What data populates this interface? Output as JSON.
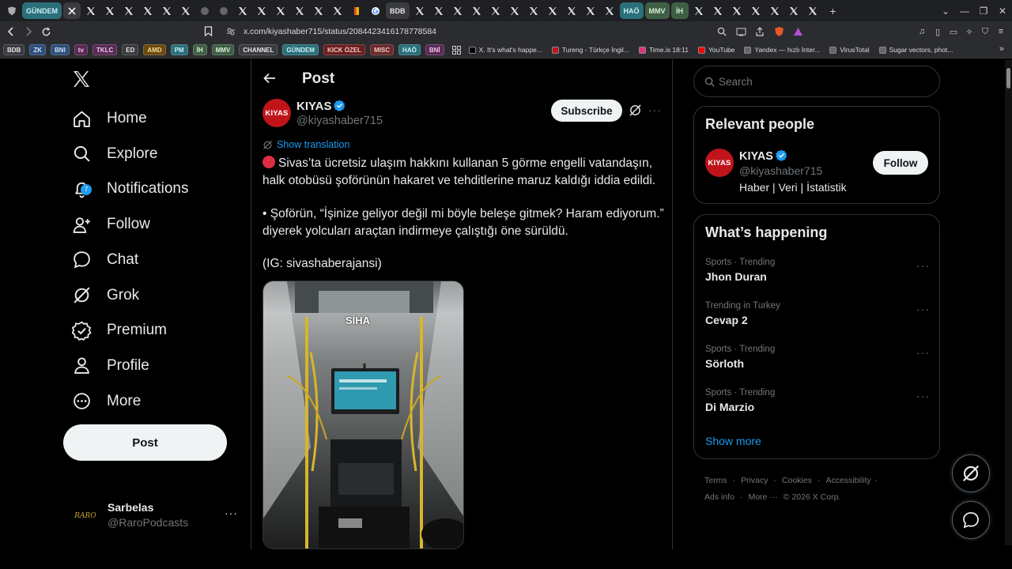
{
  "browser": {
    "tabs": [
      {
        "kind": "icon",
        "icon": "shield-icon",
        "label": ""
      },
      {
        "kind": "label",
        "label": "GÜNDEM",
        "bg": "#2a6f7a",
        "color": "#cfeff4"
      },
      {
        "kind": "icon",
        "icon": "close-icon",
        "label": "✕",
        "active": true
      },
      {
        "kind": "icon",
        "icon": "x-logo-icon",
        "label": "X"
      },
      {
        "kind": "icon",
        "icon": "x-logo-icon",
        "label": "X"
      },
      {
        "kind": "icon",
        "icon": "x-logo-icon",
        "label": "X"
      },
      {
        "kind": "icon",
        "icon": "x-logo-icon",
        "label": "X"
      },
      {
        "kind": "icon",
        "icon": "x-logo-icon",
        "label": "X"
      },
      {
        "kind": "icon",
        "icon": "x-logo-icon",
        "label": "X"
      },
      {
        "kind": "icon",
        "icon": "globe-icon",
        "label": ""
      },
      {
        "kind": "icon",
        "icon": "globe-icon",
        "label": ""
      },
      {
        "kind": "icon",
        "icon": "x-logo-icon",
        "label": "X"
      },
      {
        "kind": "icon",
        "icon": "x-logo-icon",
        "label": "X"
      },
      {
        "kind": "icon",
        "icon": "x-logo-icon",
        "label": "X"
      },
      {
        "kind": "icon",
        "icon": "x-logo-icon",
        "label": "X"
      },
      {
        "kind": "icon",
        "icon": "x-logo-icon",
        "label": "X"
      },
      {
        "kind": "icon",
        "icon": "x-logo-icon",
        "label": "X"
      },
      {
        "kind": "icon",
        "icon": "bookmark-icon",
        "label": ""
      },
      {
        "kind": "icon",
        "icon": "google-icon",
        "label": ""
      },
      {
        "kind": "label",
        "label": "BDB",
        "bg": "#3a3b3e",
        "color": "#e6e6e6"
      },
      {
        "kind": "icon",
        "icon": "x-logo-icon",
        "label": "X"
      },
      {
        "kind": "icon",
        "icon": "x-logo-icon",
        "label": "X"
      },
      {
        "kind": "icon",
        "icon": "x-logo-icon",
        "label": "X"
      },
      {
        "kind": "icon",
        "icon": "x-logo-icon",
        "label": "X"
      },
      {
        "kind": "icon",
        "icon": "x-logo-icon",
        "label": "X"
      },
      {
        "kind": "icon",
        "icon": "x-logo-icon",
        "label": "X"
      },
      {
        "kind": "icon",
        "icon": "x-logo-icon",
        "label": "X"
      },
      {
        "kind": "icon",
        "icon": "x-logo-icon",
        "label": "X"
      },
      {
        "kind": "icon",
        "icon": "x-logo-icon",
        "label": "X"
      },
      {
        "kind": "icon",
        "icon": "x-logo-icon",
        "label": "X"
      },
      {
        "kind": "icon",
        "icon": "x-logo-icon",
        "label": "X"
      },
      {
        "kind": "label",
        "label": "HAÖ",
        "bg": "#2a6f7a",
        "color": "#cfeff4"
      },
      {
        "kind": "label",
        "label": "MMV",
        "bg": "#3f5f45",
        "color": "#d7efd8"
      },
      {
        "kind": "label",
        "label": "İH",
        "bg": "#3f5f45",
        "color": "#d7efd8"
      },
      {
        "kind": "icon",
        "icon": "x-logo-icon",
        "label": "X"
      },
      {
        "kind": "icon",
        "icon": "x-logo-icon",
        "label": "X"
      },
      {
        "kind": "icon",
        "icon": "x-logo-icon",
        "label": "X"
      },
      {
        "kind": "icon",
        "icon": "x-logo-icon",
        "label": "X"
      },
      {
        "kind": "icon",
        "icon": "x-logo-icon",
        "label": "X"
      },
      {
        "kind": "icon",
        "icon": "x-logo-icon",
        "label": "X"
      },
      {
        "kind": "icon",
        "icon": "x-logo-icon",
        "label": "X"
      }
    ],
    "new_tab": "+",
    "url": "x.com/kiyashaber715/status/2084423416178778584",
    "bookmarks_labels": [
      {
        "label": "BDB",
        "bg": "#3a3b3e",
        "color": "#e6e6e6"
      },
      {
        "label": "ZK",
        "bg": "#2f4f7a",
        "color": "#cfe0f6"
      },
      {
        "label": "BNI",
        "bg": "#2f4f7a",
        "color": "#cfe0f6"
      },
      {
        "label": "tv",
        "bg": "#5a2a55",
        "color": "#f0c8ea"
      },
      {
        "label": "TKLC",
        "bg": "#5a2a55",
        "color": "#f0c8ea"
      },
      {
        "label": "ED",
        "bg": "#3a3b3e",
        "color": "#e6e6e6"
      },
      {
        "label": "AMD",
        "bg": "#6a4a10",
        "color": "#f6dc9c"
      },
      {
        "label": "PM",
        "bg": "#2a6f7a",
        "color": "#cfeff4"
      },
      {
        "label": "İH",
        "bg": "#3f5f45",
        "color": "#d7efd8"
      },
      {
        "label": "MMV",
        "bg": "#3f5f45",
        "color": "#d7efd8"
      },
      {
        "label": "CHANNEL",
        "bg": "#3a3b3e",
        "color": "#e6e6e6"
      },
      {
        "label": "GÜNDEM",
        "bg": "#2a6f7a",
        "color": "#cfeff4"
      },
      {
        "label": "KICK ÖZEL",
        "bg": "#6a1f1f",
        "color": "#f4c4c4"
      },
      {
        "label": "MISC",
        "bg": "#6a2a2a",
        "color": "#f4c4c4"
      },
      {
        "label": "HAÖ",
        "bg": "#2a6f7a",
        "color": "#cfeff4"
      },
      {
        "label": "BNİ",
        "bg": "#5a2a55",
        "color": "#f0c8ea"
      }
    ],
    "bookmarks_sites": [
      {
        "label": "X. It's what's happe...",
        "color": "#000000"
      },
      {
        "label": "Tureng - Türkçe İngil...",
        "color": "#c0141b"
      },
      {
        "label": "Time.is 18:11",
        "color": "#e0337c"
      },
      {
        "label": "YouTube",
        "color": "#ff0000"
      },
      {
        "label": "Yandex — hızlı İnter...",
        "color": "#666666"
      },
      {
        "label": "VirusTotal",
        "color": "#666666"
      },
      {
        "label": "Sugar vectors, phot...",
        "color": "#666666"
      }
    ]
  },
  "nav": {
    "items": [
      {
        "label": "Home",
        "icon": "home-icon"
      },
      {
        "label": "Explore",
        "icon": "search-icon"
      },
      {
        "label": "Notifications",
        "icon": "bell-icon",
        "badge": "7"
      },
      {
        "label": "Follow",
        "icon": "add-person-icon"
      },
      {
        "label": "Chat",
        "icon": "chat-bubble-icon"
      },
      {
        "label": "Grok",
        "icon": "grok-icon"
      },
      {
        "label": "Premium",
        "icon": "verified-badge-icon"
      },
      {
        "label": "Profile",
        "icon": "person-icon"
      },
      {
        "label": "More",
        "icon": "more-circle-icon"
      }
    ],
    "post_label": "Post",
    "account": {
      "name": "Sarbelas",
      "handle": "@RaroPodcasts",
      "avatar_text": "RARO"
    }
  },
  "post": {
    "header_title": "Post",
    "author_name": "KIYAS",
    "author_handle": "@kiyashaber715",
    "avatar_text": "KIYAS",
    "subscribe_label": "Subscribe",
    "translate_label": "Show translation",
    "paragraph1": "Sivas’ta ücretsiz ulaşım hakkını kullanan 5 görme engelli vatandaşın, halk otobüsü şoförünün hakaret ve tehditlerine maruz kaldığı iddia edildi.",
    "paragraph2": "• Şoförün, “İşinize geliyor değil mi böyle beleşe gitmek? Haram ediyorum.” diyerek yolcuları araçtan indirmeye çalıştığı öne sürüldü.",
    "paragraph3": "(IG: sivashaberajansi)",
    "media_watermark": "SİHA"
  },
  "sidebar": {
    "search_placeholder": "Search",
    "relevant": {
      "title": "Relevant people",
      "name": "KIYAS",
      "handle": "@kiyashaber715",
      "bio": "Haber | Veri | İstatistik",
      "follow_label": "Follow"
    },
    "happening": {
      "title": "What’s happening",
      "trends": [
        {
          "meta": "Sports · Trending",
          "name": "Jhon Duran"
        },
        {
          "meta": "Trending in Turkey",
          "name": "Cevap 2"
        },
        {
          "meta": "Sports · Trending",
          "name": "Sörloth"
        },
        {
          "meta": "Sports · Trending",
          "name": "Di Marzio"
        }
      ],
      "show_more": "Show more"
    },
    "footer": {
      "links": [
        "Terms",
        "Privacy",
        "Cookies",
        "Accessibility",
        "Ads info",
        "More ···"
      ],
      "copyright": "© 2026 X Corp."
    }
  },
  "colors": {
    "accent": "#1d9bf0",
    "brand_red": "#c0141b",
    "text": "#e7e9ea",
    "muted": "#71767b"
  }
}
